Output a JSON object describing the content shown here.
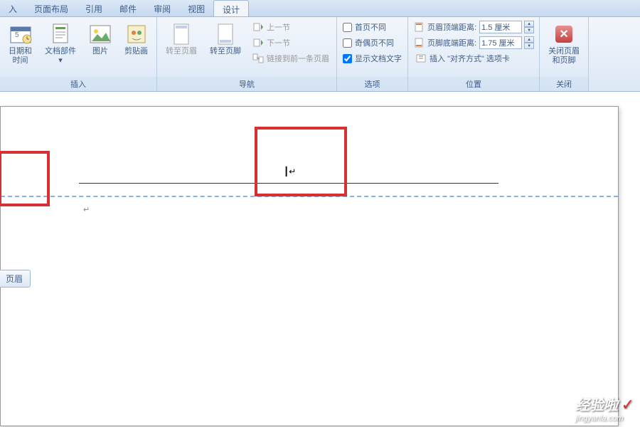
{
  "tabs": {
    "insert": "入",
    "layout": "页面布局",
    "ref": "引用",
    "mail": "邮件",
    "review": "审阅",
    "view": "视图",
    "design": "设计"
  },
  "insert_group": {
    "label": "插入",
    "datetime": "日期和\n时间",
    "docparts": "文档部件",
    "picture": "图片",
    "clipart": "剪贴画"
  },
  "nav_group": {
    "label": "导航",
    "goto_header": "转至页眉",
    "goto_footer": "转至页脚",
    "prev": "上一节",
    "next": "下一节",
    "link": "链接到前一条页眉"
  },
  "options_group": {
    "label": "选项",
    "first_diff": "首页不同",
    "odd_even": "奇偶页不同",
    "show_doc": "显示文档文字"
  },
  "position_group": {
    "label": "位置",
    "header_top": "页眉顶端距离:",
    "header_val": "1.5 厘米",
    "footer_bot": "页脚底端距离:",
    "footer_val": "1.75 厘米",
    "insert_align": "插入 \"对齐方式\" 选项卡"
  },
  "close_group": {
    "label": "关闭",
    "close_btn": "关闭页眉\n和页脚"
  },
  "doc": {
    "header_tag": "页眉",
    "cursor": "┃↵",
    "para": "↵"
  },
  "watermark": {
    "big": "经验啦",
    "small": "jingyanla.com"
  }
}
